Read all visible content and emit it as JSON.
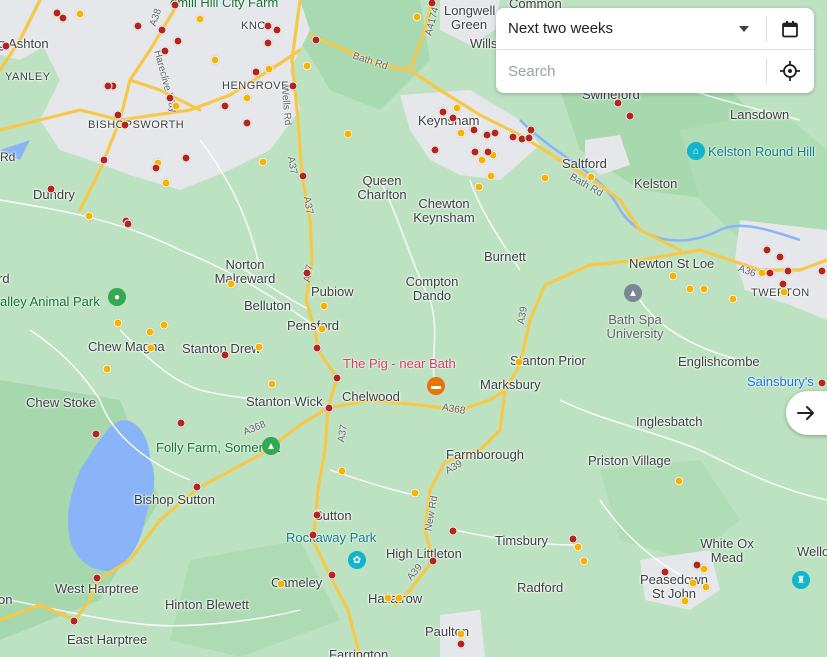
{
  "controls": {
    "period_selected": "Next two weeks",
    "search_placeholder": "Search",
    "search_value": ""
  },
  "places": [
    {
      "label": "Common"
    },
    {
      "label": "Longwell"
    },
    {
      "label": "Green"
    },
    {
      "label": "Wills"
    },
    {
      "label": "g Ashton"
    },
    {
      "label": "YANLEY"
    },
    {
      "label": "HENGROVE"
    },
    {
      "label": "KNO"
    },
    {
      "label": "BISHOPSWORTH"
    },
    {
      "label": "Keynsham"
    },
    {
      "label": "Swineford"
    },
    {
      "label": "Lansdown"
    },
    {
      "label": "Dundry"
    },
    {
      "label": "Queen Charlton"
    },
    {
      "label": "Chewton Keynsham"
    },
    {
      "label": "Saltford"
    },
    {
      "label": "Kelston"
    },
    {
      "label": "Burnett"
    },
    {
      "label": "Newton St Loe"
    },
    {
      "label": "Norton Malreward"
    },
    {
      "label": "Pubiow"
    },
    {
      "label": "Compton Dando"
    },
    {
      "label": "Belluton"
    },
    {
      "label": "Pensford"
    },
    {
      "label": "TWERTON"
    },
    {
      "label": "Chew Magna"
    },
    {
      "label": "Stanton Drew"
    },
    {
      "label": "Stanton Prior"
    },
    {
      "label": "Englishcombe"
    },
    {
      "label": "Marksbury"
    },
    {
      "label": "Chew Stoke"
    },
    {
      "label": "Stanton Wick"
    },
    {
      "label": "Chelwood"
    },
    {
      "label": "Inglesbatch"
    },
    {
      "label": "Farmborough"
    },
    {
      "label": "Priston Village"
    },
    {
      "label": "Bishop Sutton"
    },
    {
      "label": "Hinton Blewett"
    },
    {
      "label": "Sutton"
    },
    {
      "label": "High Littleton"
    },
    {
      "label": "Timsbury"
    },
    {
      "label": "White Ox Mead"
    },
    {
      "label": "Peasedown St John"
    },
    {
      "label": "Wellow"
    },
    {
      "label": "West Harptree"
    },
    {
      "label": "Cameley"
    },
    {
      "label": "Hallatrow"
    },
    {
      "label": "Radford"
    },
    {
      "label": "East Harptree"
    },
    {
      "label": "Paulton"
    },
    {
      "label": "Farrington"
    },
    {
      "label": "on"
    },
    {
      "label": "rd"
    },
    {
      "label": "Rd"
    }
  ],
  "pois": [
    {
      "label": "dmill Hill City Farm",
      "color": "#137333",
      "icon": "farm-icon"
    },
    {
      "label": "Kelston Round Hill",
      "color": "#0e7c86",
      "icon": "landmark-icon"
    },
    {
      "label": "alley Animal Park",
      "color": "#137333",
      "icon": "paw-icon"
    },
    {
      "label": "Bath Spa University",
      "color": "#5f6368",
      "icon": "graduation-cap-icon"
    },
    {
      "label": "The Pig - near Bath",
      "color": "#d93b61",
      "icon": "hotel-bed-icon"
    },
    {
      "label": "Sainsbury's",
      "color": "#1a73e8",
      "icon": "shopping-icon"
    },
    {
      "label": "Folly Farm, Somerset",
      "color": "#137333",
      "icon": "tree-icon"
    },
    {
      "label": "Rockaway Park",
      "color": "#0e7c86",
      "icon": "park-icon"
    }
  ],
  "roads": [
    {
      "label": "Bath Rd"
    },
    {
      "label": "Bath Rd"
    },
    {
      "label": "A4174"
    },
    {
      "label": "A37"
    },
    {
      "label": "A37"
    },
    {
      "label": "A37"
    },
    {
      "label": "A37"
    },
    {
      "label": "A39"
    },
    {
      "label": "A39"
    },
    {
      "label": "A39"
    },
    {
      "label": "A368"
    },
    {
      "label": "A368"
    },
    {
      "label": "A36"
    },
    {
      "label": "Wells Rd"
    },
    {
      "label": "Hareclive Way"
    },
    {
      "label": "New Rd"
    },
    {
      "label": "A38"
    }
  ],
  "colors": {
    "marker_red": "#b3261e",
    "marker_orange": "#f4b400",
    "land": "#bfe3c4",
    "urban": "#e8eaed",
    "water": "#8ab4f8",
    "major_road": "#fbd679",
    "minor_road": "#ffffff"
  }
}
